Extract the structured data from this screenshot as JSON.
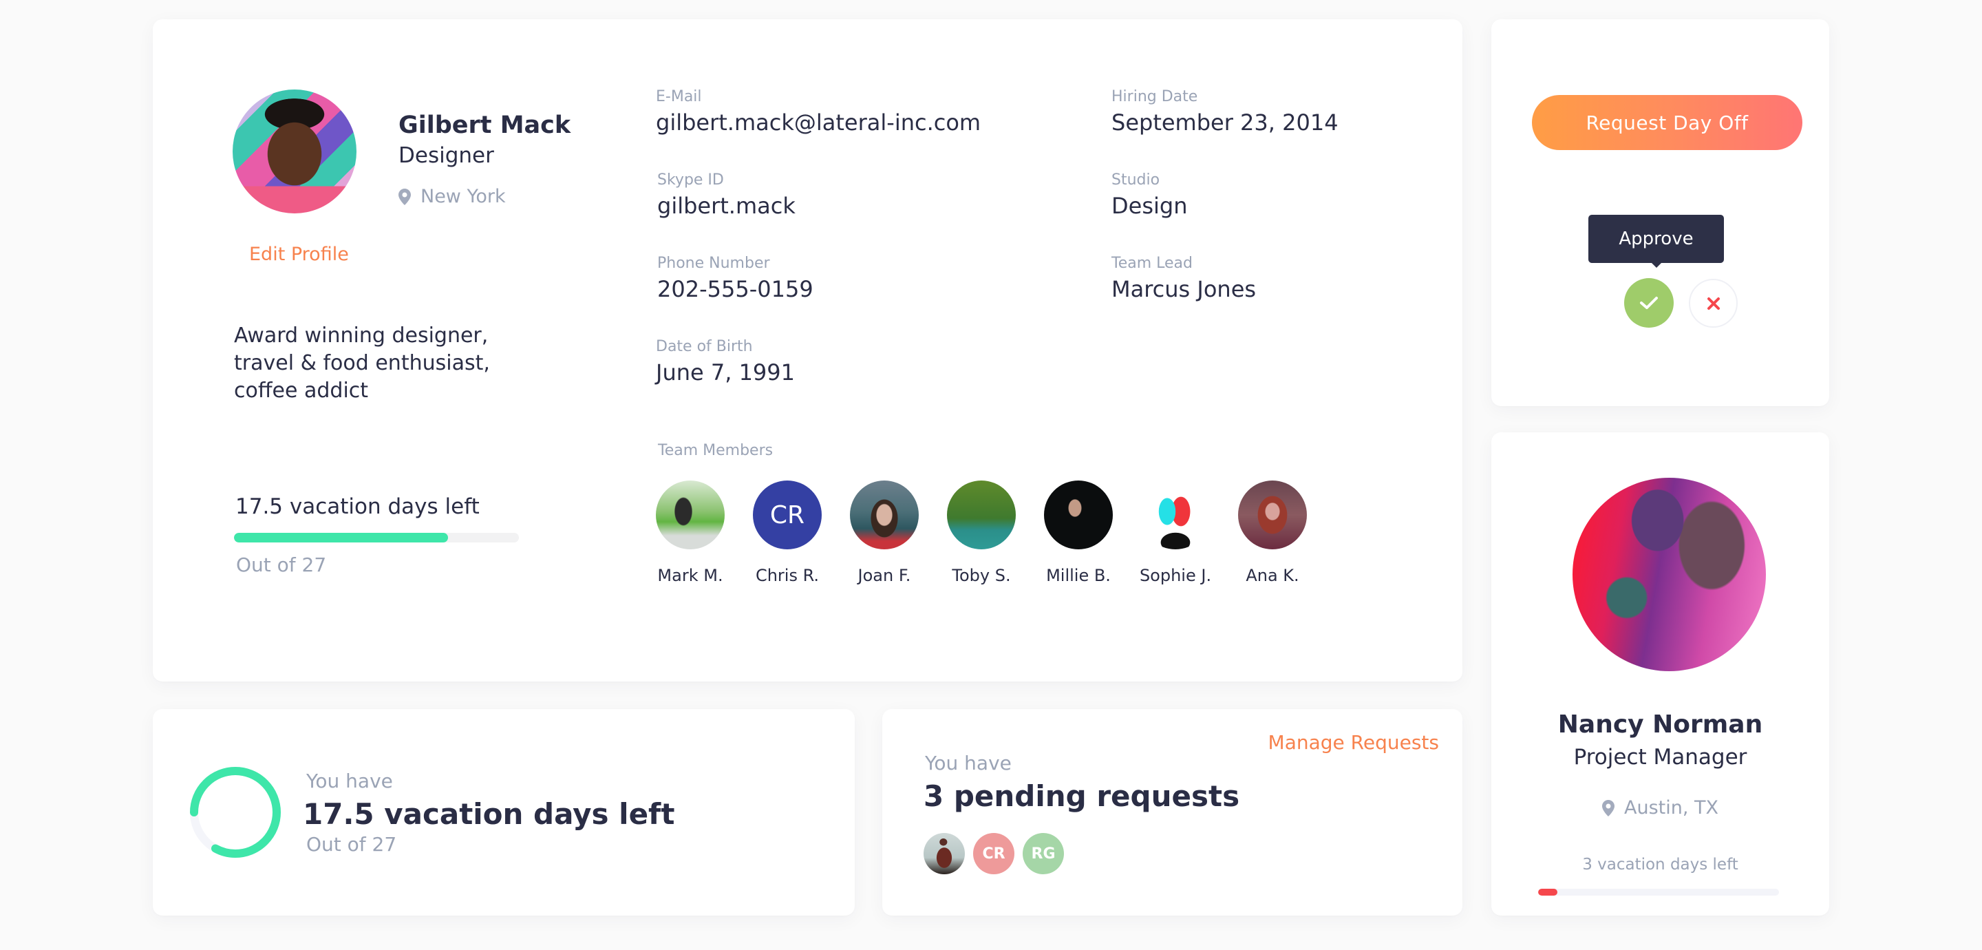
{
  "profile": {
    "name": "Gilbert Mack",
    "role": "Designer",
    "location": "New York",
    "edit_label": "Edit Profile",
    "bio": "Award winning designer, travel & food enthusiast, coffee addict",
    "vacation": {
      "label": "17.5 vacation days left",
      "out_of": "Out of 27",
      "days_left": 17.5,
      "total_days": 27,
      "bar_fill_fraction": 0.75,
      "bar_color": "#3ee6a9"
    },
    "fields": [
      {
        "label": "E-Mail",
        "value": "gilbert.mack@lateral-inc.com"
      },
      {
        "label": "Hiring Date",
        "value": "September 23, 2014"
      },
      {
        "label": "Skype ID",
        "value": "gilbert.mack"
      },
      {
        "label": "Studio",
        "value": "Design"
      },
      {
        "label": "Phone Number",
        "value": "202-555-0159"
      },
      {
        "label": "Team Lead",
        "value": "Marcus Jones"
      },
      {
        "label": "Date of Birth",
        "value": "June 7, 1991"
      }
    ],
    "team_label": "Team Members",
    "team": [
      {
        "name": "Mark M.",
        "initials": "",
        "photo": true
      },
      {
        "name": "Chris R.",
        "initials": "CR",
        "photo": false,
        "color": "#3440a3"
      },
      {
        "name": "Joan F.",
        "initials": "",
        "photo": true
      },
      {
        "name": "Toby S.",
        "initials": "",
        "photo": true
      },
      {
        "name": "Millie B.",
        "initials": "",
        "photo": true
      },
      {
        "name": "Sophie J.",
        "initials": "",
        "photo": true
      },
      {
        "name": "Ana K.",
        "initials": "",
        "photo": true
      }
    ]
  },
  "actions": {
    "request_day_off_label": "Request Day Off",
    "tooltip": "Approve",
    "approve_icon": "check-icon",
    "reject_icon": "close-icon",
    "approve_color": "#9fcc6a",
    "reject_color": "#f5474c"
  },
  "manager": {
    "name": "Nancy Norman",
    "role": "Project Manager",
    "location": "Austin, TX",
    "vacation_label": "3 vacation days left",
    "bar_fill_fraction": 0.08,
    "bar_color": "#f5474c"
  },
  "vacation_summary": {
    "prefix": "You have",
    "main": "17.5 vacation days left",
    "out_of": "Out of 27",
    "ring_fill_fraction": 0.83,
    "ring_color": "#3ee6a9"
  },
  "requests": {
    "manage_label": "Manage Requests",
    "prefix": "You have",
    "main": "3 pending requests",
    "avatars": [
      {
        "initials": "",
        "photo": true
      },
      {
        "initials": "CR",
        "color": "#ee9a9a"
      },
      {
        "initials": "RG",
        "color": "#a5d6a7"
      }
    ]
  },
  "colors": {
    "accent_orange": "#f7824d",
    "text_dark": "#2a2d45",
    "text_muted": "#9aa3b5",
    "tooltip_bg": "#2d3047"
  }
}
